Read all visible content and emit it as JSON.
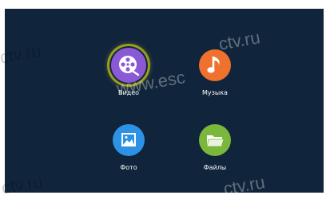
{
  "screen": {
    "background": "#10253b"
  },
  "menu": {
    "items": [
      {
        "label": "Видео",
        "icon": "video-film-icon",
        "color": "#8a5ad6",
        "selected": true
      },
      {
        "label": "Музыка",
        "icon": "music-note-icon",
        "color": "#f0702e",
        "selected": false
      },
      {
        "label": "Фото",
        "icon": "photo-icon",
        "color": "#2d92e6",
        "selected": false
      },
      {
        "label": "Файлы",
        "icon": "folder-icon",
        "color": "#7ab73a",
        "selected": false
      }
    ]
  },
  "watermark": {
    "left_top": "ctv.ru",
    "center": "www.esc",
    "center_right": "ctv.ru",
    "bottom_left": "ctv.ru",
    "bottom_right": "ctv.ru"
  }
}
